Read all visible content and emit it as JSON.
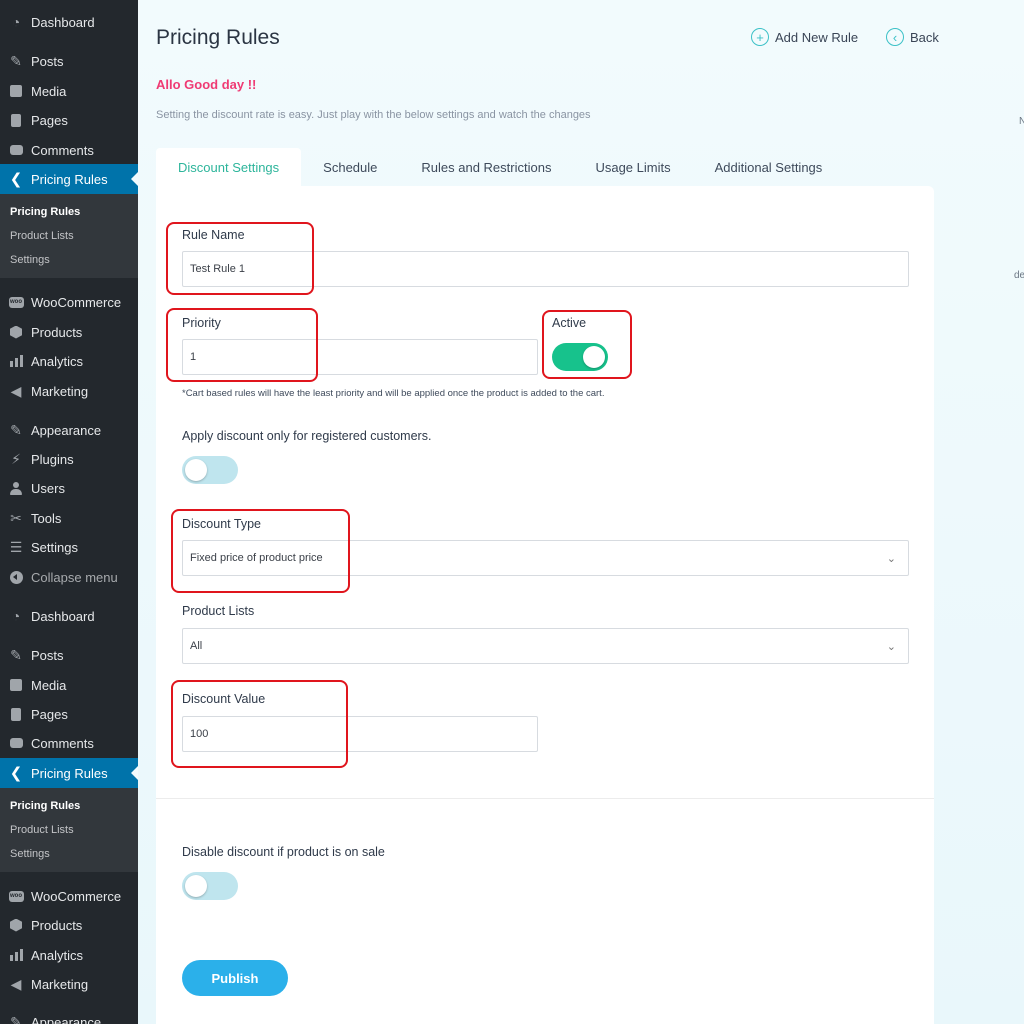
{
  "sidebar": {
    "top": [
      {
        "label": "Dashboard",
        "icon": "gauge-icon"
      },
      {
        "label": "Posts",
        "icon": "pushpin-icon"
      },
      {
        "label": "Media",
        "icon": "media-icon"
      },
      {
        "label": "Pages",
        "icon": "pages-icon"
      },
      {
        "label": "Comments",
        "icon": "comment-icon"
      },
      {
        "label": "Pricing Rules",
        "icon": "chevron-left-icon"
      }
    ],
    "submenu": [
      "Pricing Rules",
      "Product Lists",
      "Settings"
    ],
    "mid": [
      {
        "label": "WooCommerce",
        "icon": "woocommerce-icon"
      },
      {
        "label": "Products",
        "icon": "cube-icon"
      },
      {
        "label": "Analytics",
        "icon": "bar-chart-icon"
      },
      {
        "label": "Marketing",
        "icon": "megaphone-icon"
      }
    ],
    "bottom": [
      {
        "label": "Appearance",
        "icon": "paintbrush-icon"
      },
      {
        "label": "Plugins",
        "icon": "plug-icon"
      },
      {
        "label": "Users",
        "icon": "user-icon"
      },
      {
        "label": "Tools",
        "icon": "wrench-icon"
      },
      {
        "label": "Settings",
        "icon": "sliders-icon"
      },
      {
        "label": "Collapse menu",
        "icon": "collapse-icon"
      }
    ],
    "repeat_last": "Appearance"
  },
  "header": {
    "title": "Pricing Rules",
    "add_new_rule": "Add New Rule",
    "back": "Back",
    "add_icon_glyph": "+",
    "back_icon_glyph": "‹",
    "greeting": "Allo Good day !!",
    "subtext": "Setting the discount rate is easy. Just play with the below settings and watch the changes"
  },
  "tabs": [
    "Discount Settings",
    "Schedule",
    "Rules and Restrictions",
    "Usage Limits",
    "Additional Settings"
  ],
  "form": {
    "rule_name_label": "Rule Name",
    "rule_name_value": "Test Rule 1",
    "priority_label": "Priority",
    "priority_value": "1",
    "active_label": "Active",
    "active_on": true,
    "priority_note": "*Cart based rules will have the least priority and will be applied once the product is added to the cart.",
    "registered_label": "Apply discount only for registered customers.",
    "registered_on": false,
    "discount_type_label": "Discount Type",
    "discount_type_value": "Fixed price of product price",
    "product_lists_label": "Product Lists",
    "product_lists_value": "All",
    "discount_value_label": "Discount Value",
    "discount_value_value": "100",
    "on_sale_label": "Disable discount if product is on sale",
    "on_sale_on": false,
    "publish_label": "Publish"
  },
  "edge_texts": [
    "N",
    "de"
  ],
  "colors": {
    "sidebar_bg": "#23282d",
    "wp_active": "#0073aa",
    "tab_active_text": "#2db59b",
    "greeting": "#ef3b74",
    "toggle_on": "#17c28c",
    "toggle_off": "#bfe5ee",
    "publish": "#2bb0ea",
    "highlight": "#e0151d"
  }
}
